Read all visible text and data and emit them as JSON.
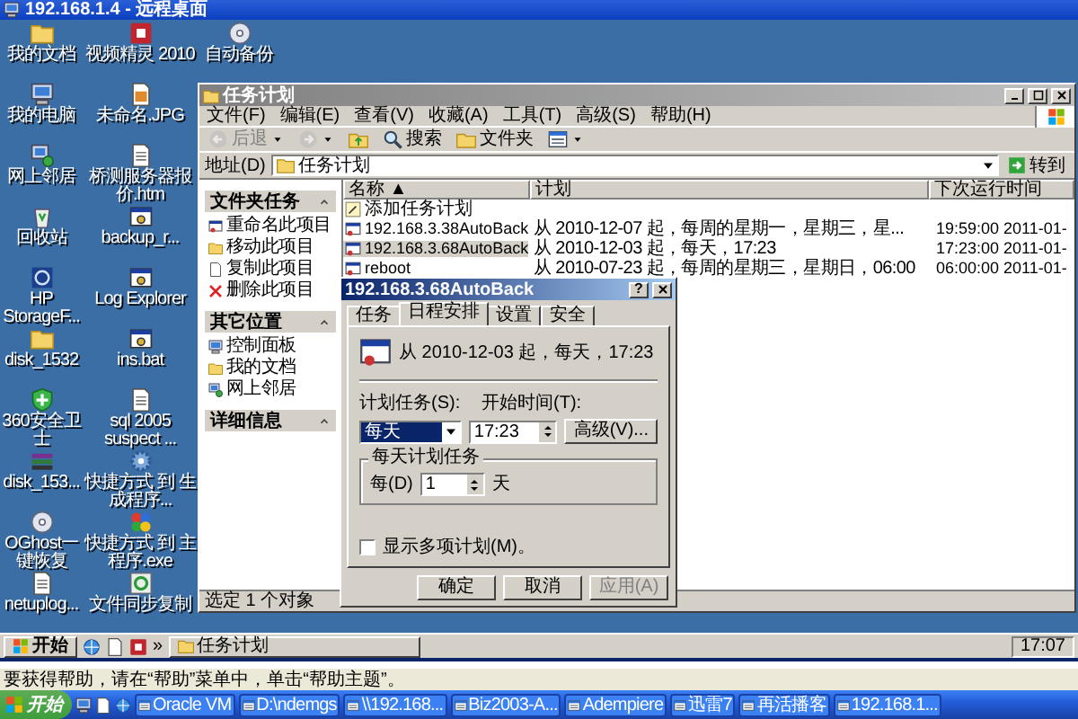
{
  "remote_desktop": {
    "title": "192.168.1.4 - 远程桌面"
  },
  "desktop_columns": [
    {
      "icons": [
        {
          "kind": "folder",
          "label": "我的文档"
        },
        {
          "kind": "computer",
          "label": "我的电脑"
        },
        {
          "kind": "network",
          "label": "网上邻居"
        },
        {
          "kind": "recycle",
          "label": "回收站"
        },
        {
          "kind": "swirl",
          "label": "HP StorageF..."
        },
        {
          "kind": "folder",
          "label": "disk_1532"
        },
        {
          "kind": "shield",
          "label": "360安全卫士"
        },
        {
          "kind": "archive",
          "label": "disk_153..."
        },
        {
          "kind": "disc",
          "label": "OGhost一键恢复"
        },
        {
          "kind": "document",
          "label": "netuplog..."
        }
      ]
    },
    {
      "icons": [
        {
          "kind": "app",
          "label": "视频精灵 2010"
        },
        {
          "kind": "image",
          "label": "未命名.JPG"
        },
        {
          "kind": "document",
          "label": "桥测服务器报价.htm"
        },
        {
          "kind": "bat",
          "label": "backup_r..."
        },
        {
          "kind": "bat",
          "label": "Log Explorer"
        },
        {
          "kind": "bat",
          "label": "ins.bat"
        },
        {
          "kind": "document",
          "label": "sql 2005 suspect ..."
        },
        {
          "kind": "gear",
          "label": "快捷方式 到 生成程序..."
        },
        {
          "kind": "palette",
          "label": "快捷方式 到 主程序.exe"
        },
        {
          "kind": "sync",
          "label": "文件同步复制"
        }
      ]
    },
    {
      "icons": [
        {
          "kind": "disc",
          "label": "自动备份"
        }
      ]
    }
  ],
  "explorer": {
    "title": "任务计划",
    "menu": [
      "文件(F)",
      "编辑(E)",
      "查看(V)",
      "收藏(A)",
      "工具(T)",
      "高级(S)",
      "帮助(H)"
    ],
    "toolbar": [
      {
        "kind": "back",
        "label": "后退",
        "disabled": true
      },
      {
        "kind": "forward",
        "disabled": true
      },
      {
        "kind": "up",
        "disabled": false
      },
      {
        "kind": "search",
        "label": "搜索",
        "disabled": false
      },
      {
        "kind": "folders",
        "label": "文件夹",
        "disabled": false
      },
      {
        "kind": "views",
        "disabled": false
      }
    ],
    "address": {
      "label": "地址(D)",
      "value": "任务计划",
      "go": "转到"
    },
    "side_panels": [
      {
        "title": "文件夹任务",
        "items": [
          {
            "kind": "rename",
            "label": "重命名此项目"
          },
          {
            "kind": "move",
            "label": "移动此项目"
          },
          {
            "kind": "copy",
            "label": "复制此项目"
          },
          {
            "kind": "delete",
            "label": "删除此项目"
          }
        ]
      },
      {
        "title": "其它位置",
        "items": [
          {
            "kind": "control",
            "label": "控制面板"
          },
          {
            "kind": "documents",
            "label": "我的文档"
          },
          {
            "kind": "network",
            "label": "网上邻居"
          }
        ]
      },
      {
        "title": "详细信息"
      }
    ],
    "table": {
      "columns": [
        "名称 ▲",
        "计划",
        "下次运行时间"
      ],
      "rows": [
        {
          "kind": "wizard",
          "name": "添加任务计划",
          "selected": false
        },
        {
          "kind": "task",
          "name": "192.168.3.38AutoBack",
          "schedule": "从 2010-12-07 起，每周的星期一，星期三，星...",
          "next_run": "19:59:00  2011-01-",
          "selected": false
        },
        {
          "kind": "task",
          "name": "192.168.3.68AutoBack",
          "schedule": "从 2010-12-03 起，每天，17:23",
          "next_run": "17:23:00  2011-01-",
          "selected": true
        },
        {
          "kind": "task",
          "name": "reboot",
          "schedule": "从 2010-07-23 起，每周的星期三，星期日，06:00",
          "next_run": "06:00:00  2011-01-",
          "selected": false
        }
      ]
    },
    "status": "选定 1 个对象"
  },
  "dialog": {
    "title": "192.168.3.68AutoBack",
    "help": "?",
    "tabs": [
      {
        "label": "任务",
        "selected": false
      },
      {
        "label": "日程安排",
        "selected": true
      },
      {
        "label": "设置",
        "selected": false
      },
      {
        "label": "安全",
        "selected": false
      }
    ],
    "summary": "从 2010-12-03 起，每天，17:23",
    "schedule_label": "计划任务(S):",
    "schedule_value": "每天",
    "start_label": "开始时间(T):",
    "start_value": "17:23",
    "advanced": "高级(V)...",
    "group_title": "每天计划任务",
    "every_label": "每(D)",
    "every_value": "1",
    "every_unit": "天",
    "multiple": {
      "label": "显示多项计划(M)。",
      "checked": false
    },
    "buttons": [
      {
        "label": "确定",
        "disabled": false
      },
      {
        "label": "取消",
        "disabled": false
      },
      {
        "label": "应用(A)",
        "disabled": true
      }
    ]
  },
  "inner_taskbar": {
    "start": "开始",
    "more": "»",
    "tasks": [
      {
        "label": "任务计划"
      }
    ],
    "clock": "17:07"
  },
  "status_bar": "要获得帮助，请在“帮助”菜单中，单击“帮助主题”。",
  "taskbar": {
    "start": "开始",
    "tasks": [
      {
        "label": "Oracle VM"
      },
      {
        "label": "D:\\ndemgs"
      },
      {
        "label": "\\\\192.168..."
      },
      {
        "label": "Biz2003-A..."
      },
      {
        "label": "Adempiere"
      },
      {
        "label": "迅雷7"
      },
      {
        "label": "再活播客"
      },
      {
        "label": "192.168.1..."
      }
    ]
  }
}
